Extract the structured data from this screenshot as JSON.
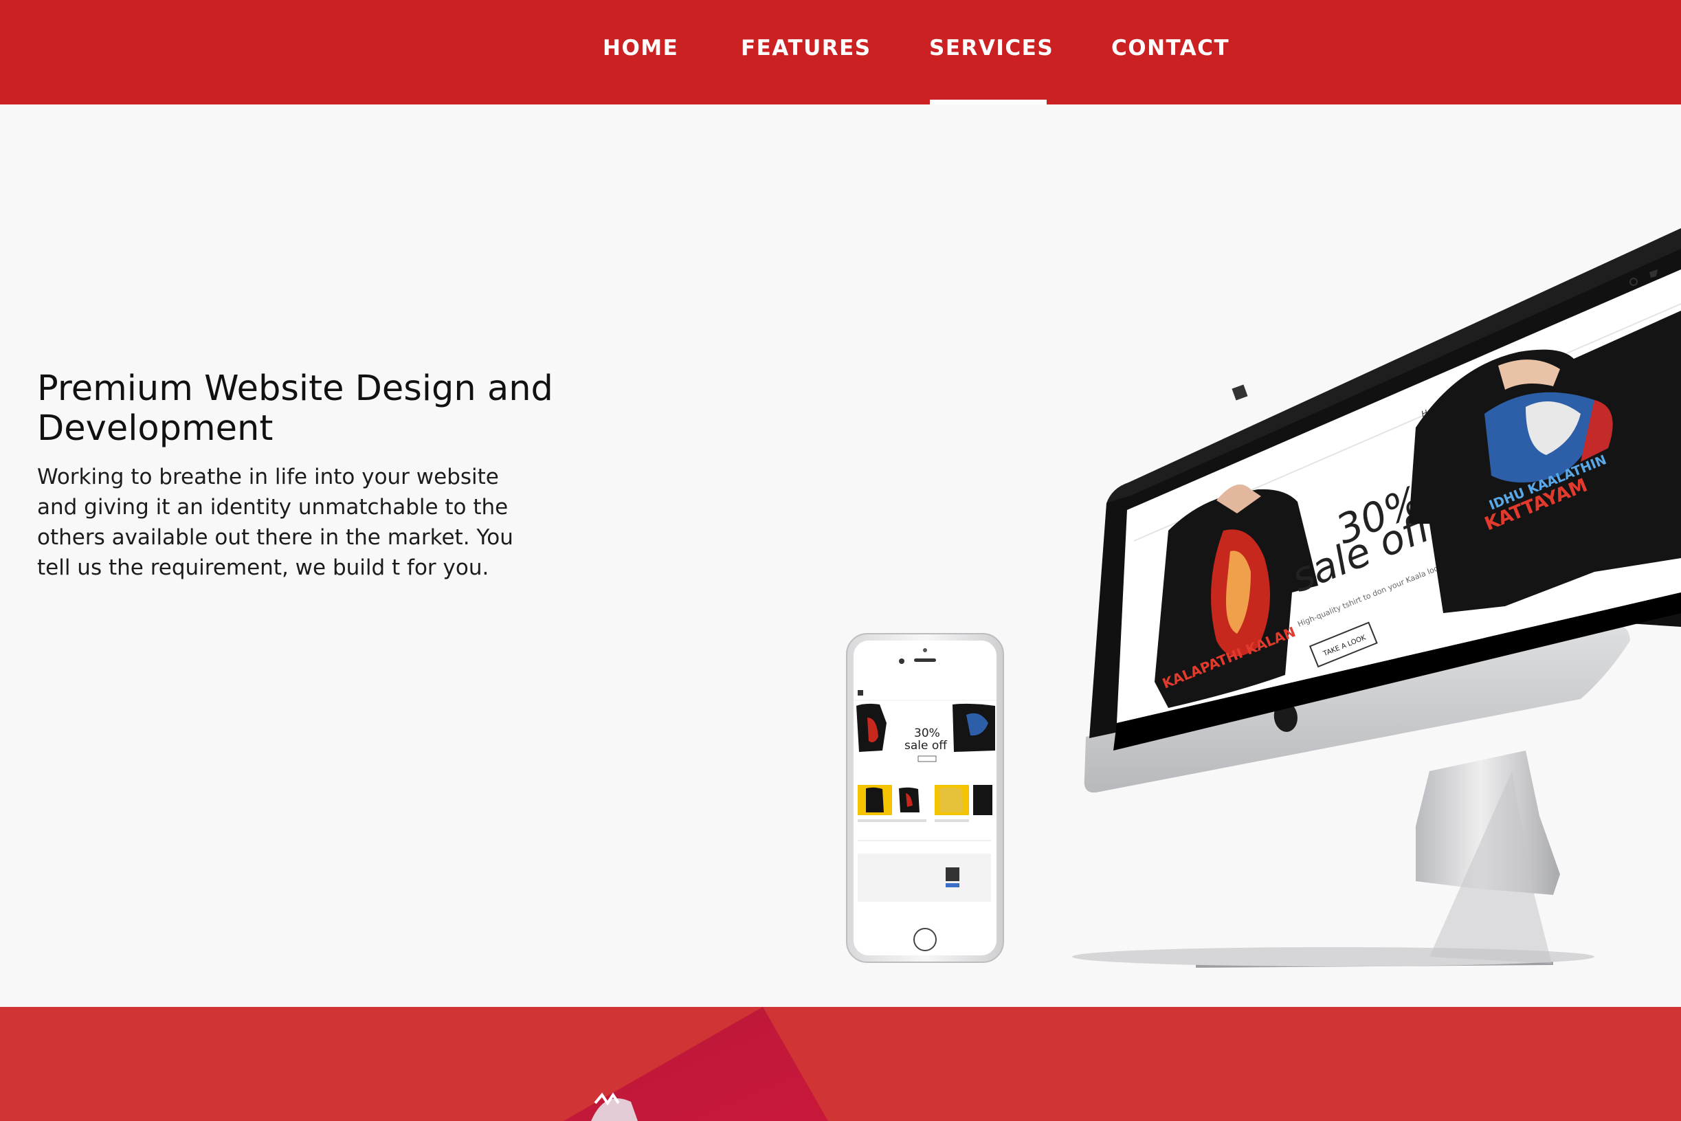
{
  "nav": {
    "items": [
      {
        "label": "HOME"
      },
      {
        "label": "FEATURES"
      },
      {
        "label": "SERVICES"
      },
      {
        "label": "CONTACT"
      }
    ],
    "active": "SERVICES"
  },
  "hero": {
    "title": "Premium Website Design and Development",
    "description": "Working to breathe in life into your website and giving it an identity unmatchable to the others available out there in the market. You tell us the requirement, we build t for you."
  },
  "mockup": {
    "desktop_promo_line1": "30%",
    "desktop_promo_line2": "sale off",
    "desktop_subtext": "High-quality tshirt to don your Kaala look in.",
    "desktop_button": "TAKE A LOOK",
    "desktop_nav_label": "Home",
    "shirt_left_text": "KALAPATHI KALAN",
    "shirt_right_text_line1": "IDHU KAALATHIN",
    "shirt_right_text_line2": "KATTAYAM",
    "phone_promo_line1": "30%",
    "phone_promo_line2": "sale off"
  },
  "colors": {
    "brand_red": "#cc2122",
    "bottom_red": "#d13434",
    "page_bg": "#f8f8f8"
  }
}
